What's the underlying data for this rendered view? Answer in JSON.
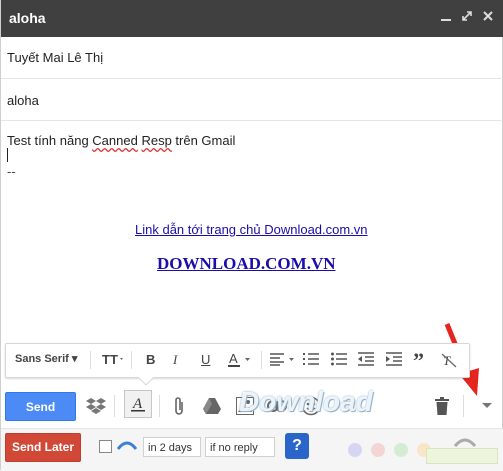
{
  "window": {
    "title": "aloha",
    "controls": [
      "minimize",
      "expand",
      "close"
    ]
  },
  "fields": {
    "to_value": "Tuyết Mai Lê Thị",
    "subject_value": "aloha"
  },
  "body": {
    "line1_prefix": "Test tính năng ",
    "line1_word1": "Canned",
    "line1_space": " ",
    "line1_word2": "Resp",
    "line1_suffix": " trên Gmail",
    "signature_sep": "--",
    "link1": "Link dẫn tới trang chủ Download.com.vn",
    "link2": "DOWNLOAD.COM.VN"
  },
  "format_toolbar": {
    "font": "Sans Serif",
    "items": [
      "font-size",
      "bold",
      "italic",
      "underline",
      "text-color",
      "align",
      "numbered-list",
      "bulleted-list",
      "indent-less",
      "indent-more",
      "quote",
      "remove-formatting"
    ]
  },
  "toolbar": {
    "send_label": "Send",
    "icons": [
      "dropbox",
      "formatting",
      "attach",
      "drive",
      "photo",
      "link",
      "emoji",
      "discard",
      "more-options"
    ]
  },
  "bottom": {
    "send_later_label": "Send Later",
    "remind_days": "in 2 days",
    "remind_condition": "if no reply"
  },
  "watermark": "Download",
  "colors": {
    "titlebar": "#404040",
    "send": "#4c8bf5",
    "send_later": "#d14836",
    "link": "#1a0dab",
    "arrow": "#e5261f"
  }
}
